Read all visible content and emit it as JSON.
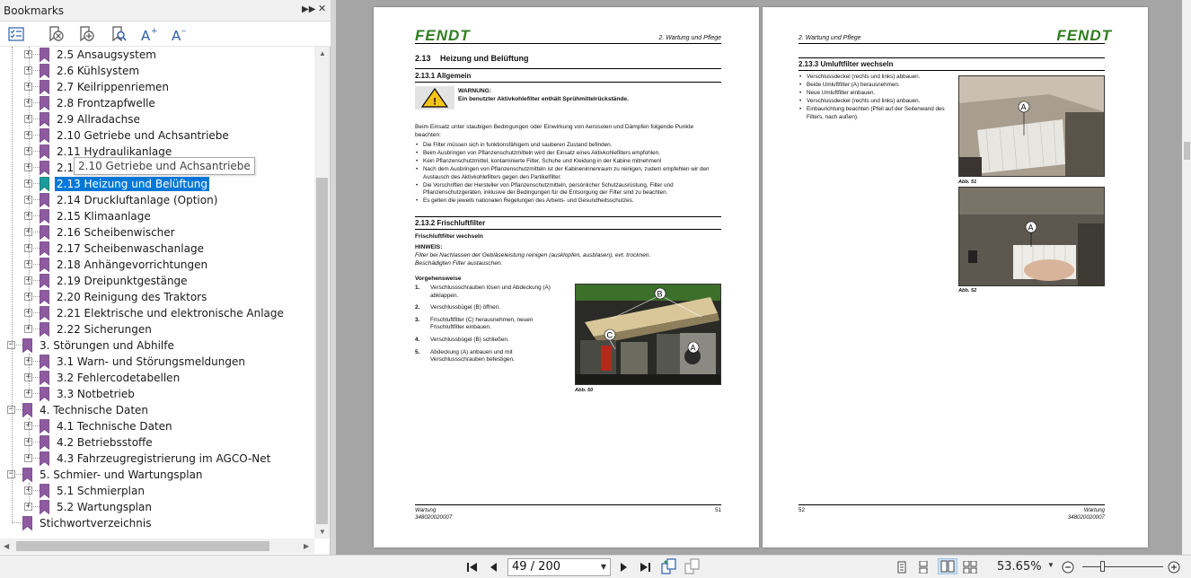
{
  "bookmarks_panel": {
    "title": "Bookmarks",
    "tooltip": "2.10 Getriebe und Achsantriebe",
    "items": [
      {
        "label": "2.5 Ansaugsystem",
        "level": 2
      },
      {
        "label": "2.6 Kühlsystem",
        "level": 2
      },
      {
        "label": "2.7 Keilrippenriemen",
        "level": 2
      },
      {
        "label": "2.8 Frontzapfwelle",
        "level": 2
      },
      {
        "label": "2.9 Allradachse",
        "level": 2
      },
      {
        "label": "2.10 Getriebe und Achsantriebe",
        "level": 2
      },
      {
        "label": "2.11 Hydraulikanlage",
        "level": 2
      },
      {
        "label": "2.1",
        "level": 2
      },
      {
        "label": "2.13 Heizung und Belüftung",
        "level": 2,
        "selected": true
      },
      {
        "label": "2.14 Druckluftanlage (Option)",
        "level": 2
      },
      {
        "label": "2.15 Klimaanlage",
        "level": 2
      },
      {
        "label": "2.16 Scheibenwischer",
        "level": 2
      },
      {
        "label": "2.17 Scheibenwaschanlage",
        "level": 2
      },
      {
        "label": "2.18 Anhängevorrichtungen",
        "level": 2
      },
      {
        "label": "2.19 Dreipunktgestänge",
        "level": 2
      },
      {
        "label": "2.20 Reinigung des Traktors",
        "level": 2
      },
      {
        "label": "2.21 Elektrische und elektronische Anlage",
        "level": 2
      },
      {
        "label": "2.22 Sicherungen",
        "level": 2
      },
      {
        "label": "3. Störungen und Abhilfe",
        "level": 1,
        "expanded": true
      },
      {
        "label": "3.1 Warn- und Störungsmeldungen",
        "level": 2
      },
      {
        "label": "3.2 Fehlercodetabellen",
        "level": 2
      },
      {
        "label": "3.3 Notbetrieb",
        "level": 2
      },
      {
        "label": "4. Technische Daten",
        "level": 1,
        "expanded": true
      },
      {
        "label": "4.1 Technische Daten",
        "level": 2
      },
      {
        "label": "4.2 Betriebsstoffe",
        "level": 2
      },
      {
        "label": "4.3 Fahrzeugregistrierung im AGCO-Net",
        "level": 2
      },
      {
        "label": "5. Schmier- und Wartungsplan",
        "level": 1,
        "expanded": true
      },
      {
        "label": "5.1 Schmierplan",
        "level": 2
      },
      {
        "label": "5.2 Wartungsplan",
        "level": 2
      },
      {
        "label": "Stichwortverzeichnis",
        "level": 1,
        "leaf": true
      }
    ]
  },
  "page_left": {
    "logo": "FENDT",
    "header_right": "2. Wartung und Pflege",
    "section_num": "2.13",
    "section_title": "Heizung und Belüftung",
    "sub1": "2.13.1  Allgemein",
    "warning_title": "WARNUNG:",
    "warning_text": "Ein benutzter Aktivkohlefilter enthält Sprühmittelrückstände.",
    "intro": "Beim Einsatz unter staubigen Bedingungen oder Einwirkung von Aerosolen und Dämpfen folgende Punkte beachten:",
    "bullets": [
      "Die Filter müssen sich in funktionsfähigem und sauberen Zustand befinden.",
      "Beim Ausbringen von Pflanzenschutzmitteln wird der Einsatz eines Aktivkohlefilters empfohlen.",
      "Kein Pflanzenschutzmittel, kontaminierte Filter, Schuhe und Kleidung in der Kabine mitnehmen!",
      "Nach dem Ausbringen von Pflanzenschutzmitteln ist der Kabineninnenraum zu reinigen, zudem empfehlen wir den Austausch des Aktivkohlefilters gegen den Partikelfilter.",
      "Die Vorschriften der Hersteller von Pflanzenschutzmitteln, persönlicher Schutzausrüstung, Filter und Pflanzenschutzgeräten, inklusive der Bedingungen für die Entsorgung der Filter sind zu beachten.",
      "Es gelten die jeweils nationalen Regelungen des Arbeits- und Gesundheitsschutzes."
    ],
    "sub2": "2.13.2  Frischluftfilter",
    "sub2_heading": "Frischluftfilter wechseln",
    "hinweis_title": "HINWEIS:",
    "hinweis_text": "Filter bei Nachlassen der Gebläseleistung reinigen (ausklopfen, ausblasen), evt. trocknen. Beschädigten Filter austauschen.",
    "procedure_title": "Vorgehensweise",
    "steps": [
      {
        "n": "1.",
        "text": "Verschlussschrauben lösen und Abdeckung (A) abklappen."
      },
      {
        "n": "2.",
        "text": "Verschlussbügel (B) öffnen."
      },
      {
        "n": "3.",
        "text": "Frischluftfilter (C) herausnehmen, neuen Frischluftfilter einbauen."
      },
      {
        "n": "4.",
        "text": "Verschlussbügel (B) schließen."
      },
      {
        "n": "5.",
        "text": "Abdeckung (A) anbauen und mit Verschlussschrauben befestigen."
      }
    ],
    "photo_labels": [
      "B",
      "C",
      "A"
    ],
    "caption": "Abb. 50",
    "footer_left_1": "Wartung",
    "footer_left_2": "348020020007",
    "page_number": "51"
  },
  "page_right": {
    "logo": "FENDT",
    "header_left": "2. Wartung und Pflege",
    "sub3": "2.13.3  Umluftfilter wechseln",
    "bullets": [
      "Verschlussdeckel (rechts und links) abbauen.",
      "Beide Umluftfilter (A) herausnehmen.",
      "Neue Umluftfilter einbauen.",
      "Verschlussdeckel (rechts und links) anbauen.",
      "Einbaurichtung beachten (Pfeil auf der Seitenwand des Filters, nach außen)."
    ],
    "photo1_label": "A",
    "caption1": "Abb. 51",
    "photo2_label": "A",
    "caption2": "Abb. 52",
    "footer_left": "52",
    "footer_right_1": "Wartung",
    "footer_right_2": "348020020007"
  },
  "bottom_toolbar": {
    "page_field": "49 / 200",
    "zoom": "53.65%"
  },
  "colors": {
    "fendt_green": "#2f7d1f",
    "selection": "#0078d7",
    "bookmark_purple": "#8e5aa0",
    "bookmark_teal": "#1a9c9c",
    "canvas_gray": "#a5a5a5"
  }
}
